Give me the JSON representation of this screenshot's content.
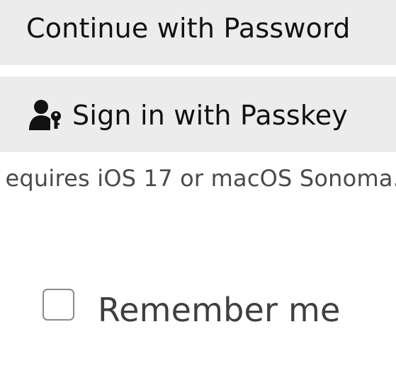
{
  "buttons": {
    "password_label": "Continue with Password",
    "passkey_label": "Sign in with Passkey",
    "passkey_icon": "person-key-icon"
  },
  "passkey_note": "equires iOS 17 or macOS Sonoma.",
  "remember": {
    "label": "Remember me",
    "checked": false
  },
  "colors": {
    "button_bg": "#ececec",
    "text": "#111111",
    "note_text": "#4a4a4a",
    "checkbox_border": "#8a8a8a"
  }
}
